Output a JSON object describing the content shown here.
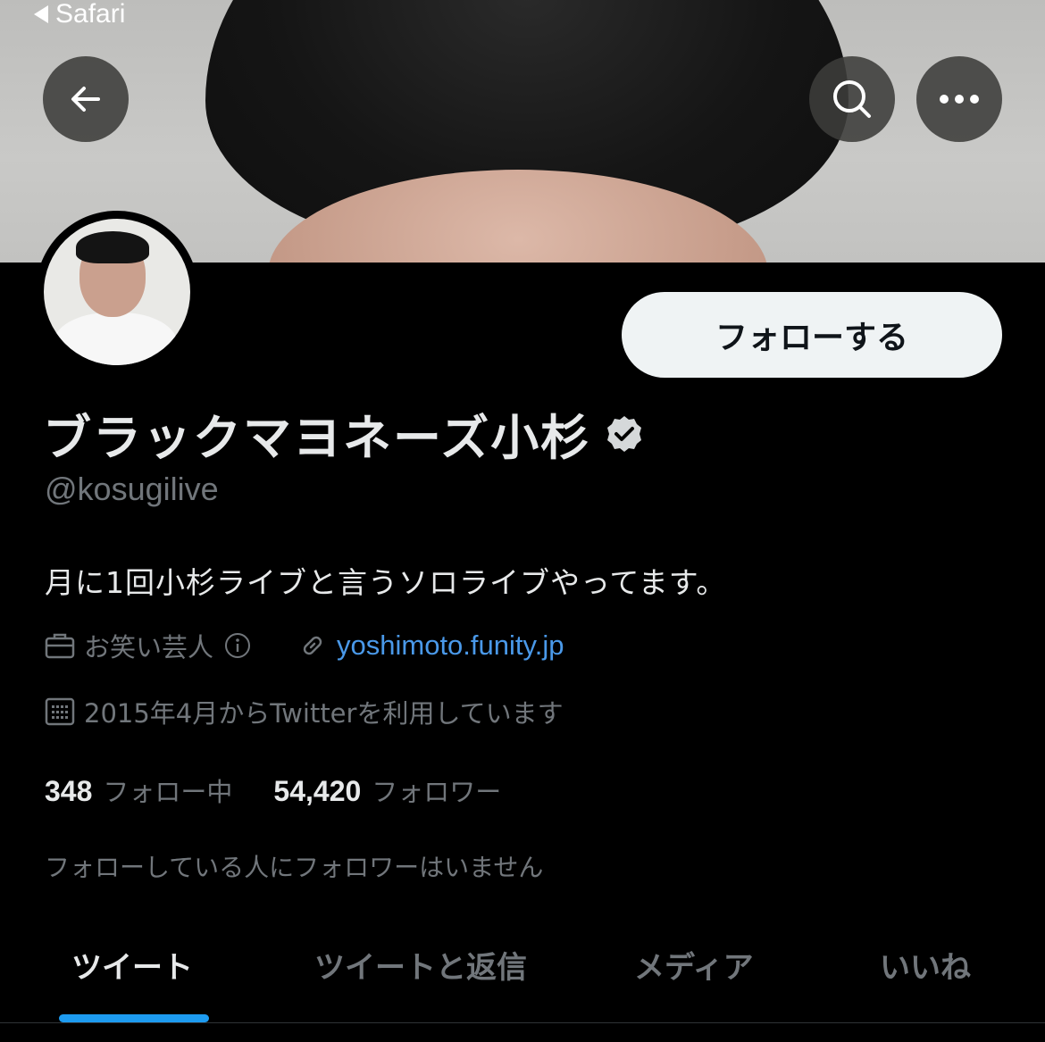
{
  "status_bar": {
    "back_app_label": "Safari"
  },
  "header": {
    "back_icon": "arrow-left-icon",
    "search_icon": "search-icon",
    "more_icon": "more-horizontal-icon"
  },
  "profile": {
    "follow_button_label": "フォローする",
    "display_name": "ブラックマヨネーズ小杉",
    "verified_icon": "verified-badge-icon",
    "handle": "@kosugilive",
    "bio": "月に1回小杉ライブと言うソロライブやってます。",
    "category": "お笑い芸人",
    "category_info_icon": "info-icon",
    "website": "yoshimoto.funity.jp",
    "joined": "2015年4月からTwitterを利用しています",
    "following_count": "348",
    "following_label": "フォロー中",
    "followers_count": "54,420",
    "followers_label": "フォロワー",
    "mutual_note": "フォローしている人にフォロワーはいません"
  },
  "tabs": [
    {
      "label": "ツイート",
      "active": true
    },
    {
      "label": "ツイートと返信",
      "active": false
    },
    {
      "label": "メディア",
      "active": false
    },
    {
      "label": "いいね",
      "active": false
    }
  ],
  "colors": {
    "background": "#000000",
    "accent": "#1d9bf0",
    "link": "#4a99e9",
    "muted_text": "#71767b",
    "primary_text": "#e7e9ea"
  }
}
